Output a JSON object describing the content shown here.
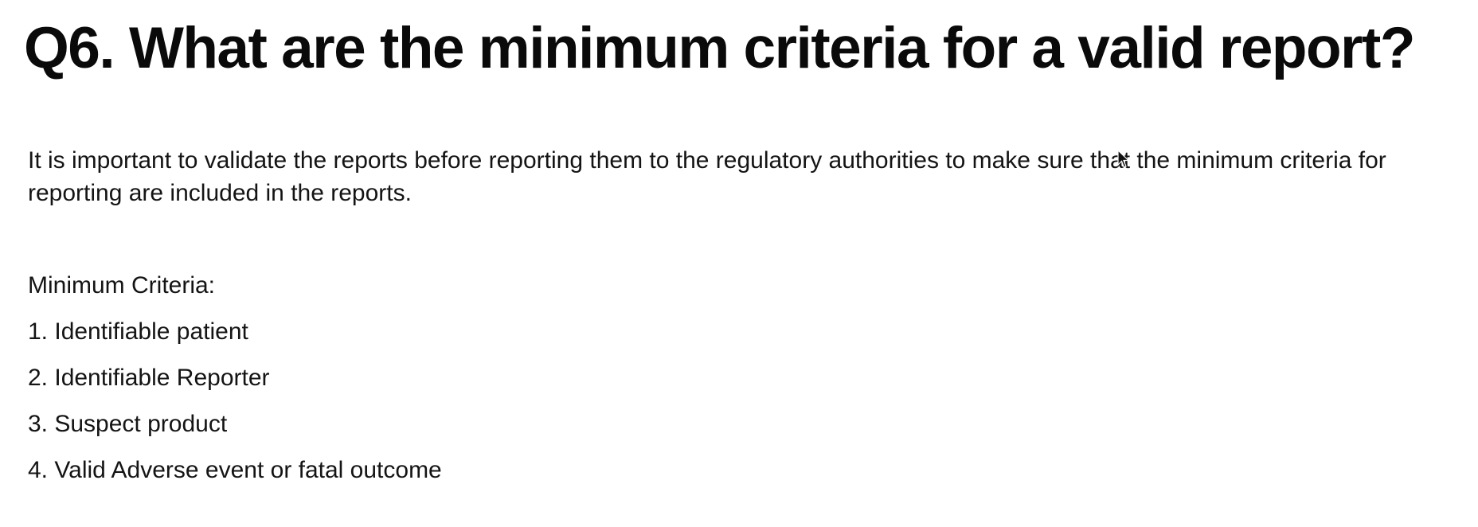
{
  "slide": {
    "title": "Q6. What are the minimum criteria for a valid report?",
    "intro": "It is important to validate the reports before reporting them to the regulatory authorities to make sure that the minimum criteria for reporting are included in the reports.",
    "criteria_heading": "Minimum Criteria:",
    "criteria": [
      "1. Identifiable patient",
      "2. Identifiable Reporter",
      "3. Suspect product",
      "4. Valid Adverse event or fatal outcome"
    ]
  },
  "icons": {
    "cursor": "mouse-pointer-icon"
  }
}
